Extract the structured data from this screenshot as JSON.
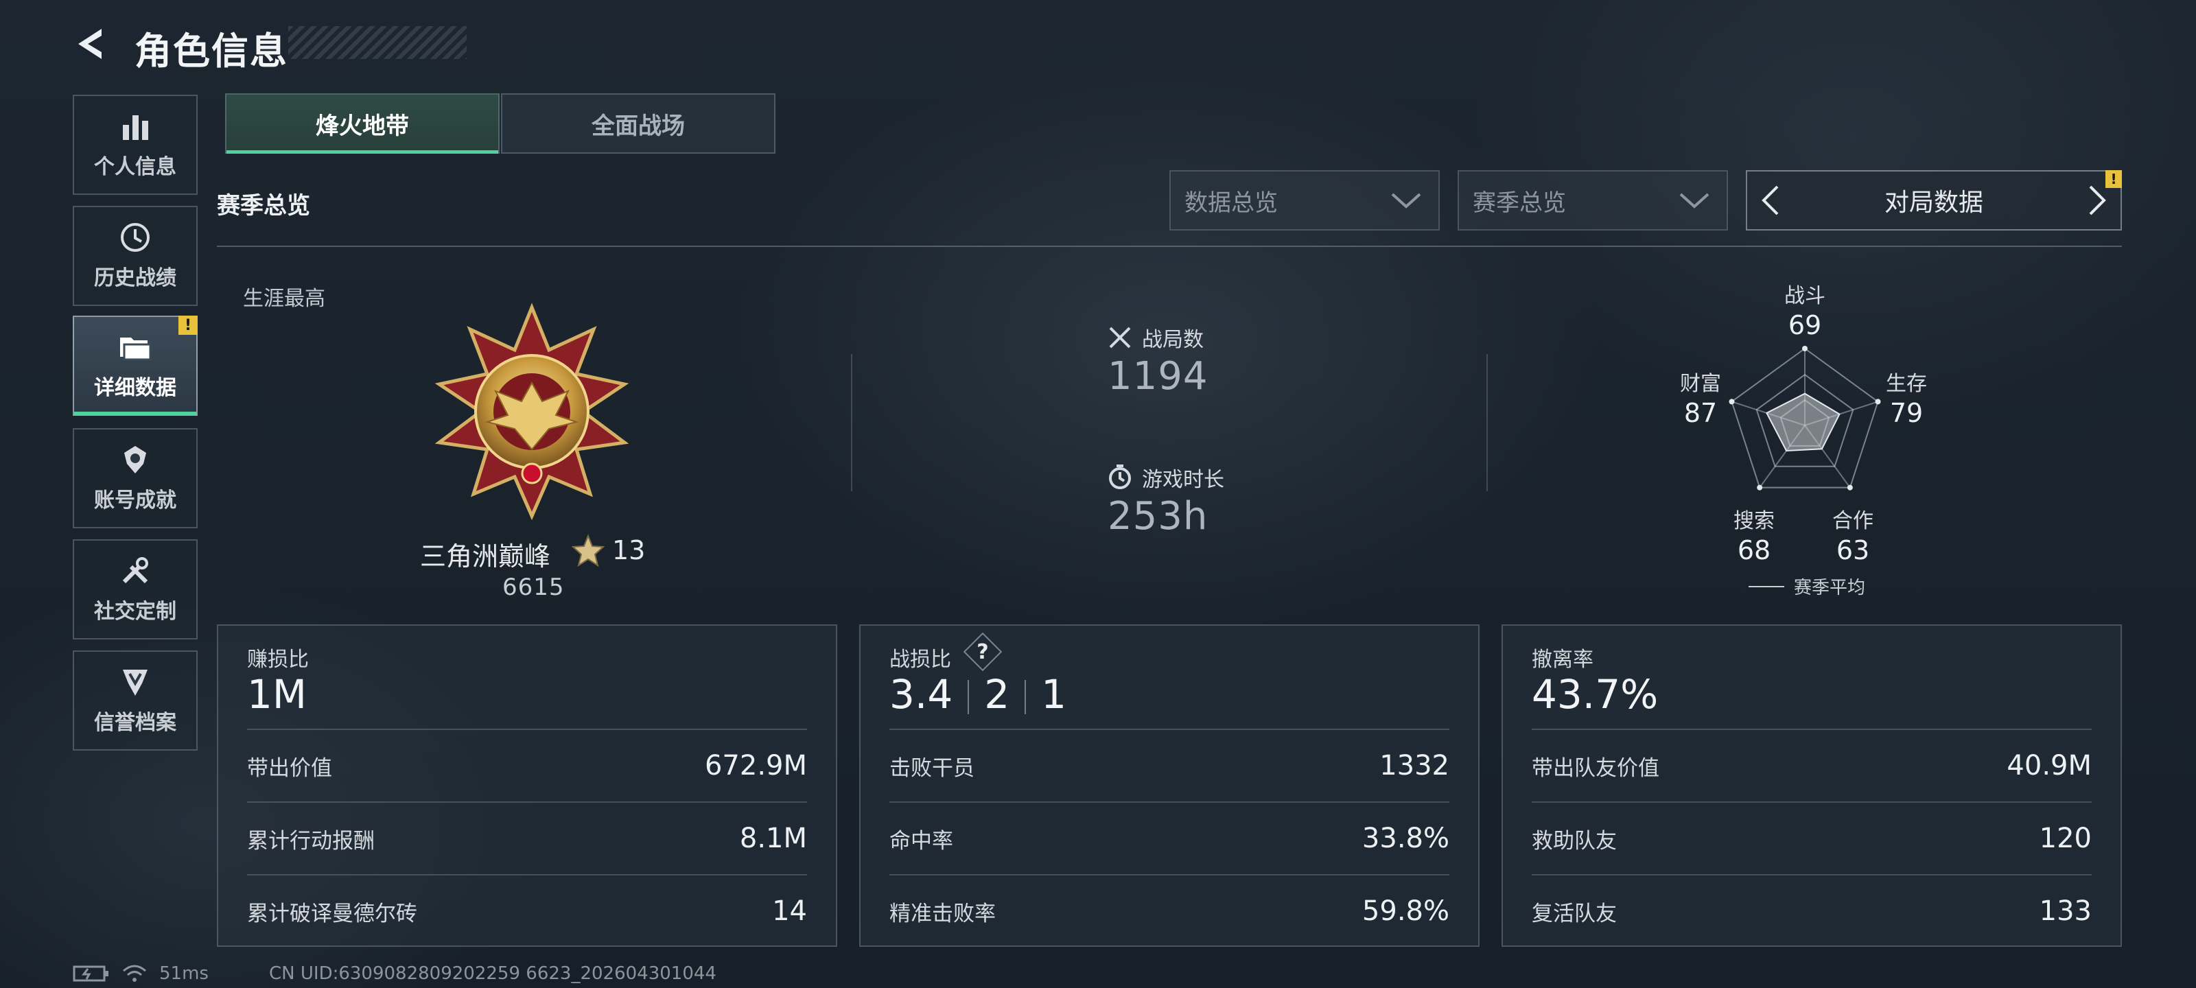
{
  "header": {
    "title": "角色信息"
  },
  "nav": {
    "items": [
      {
        "label": "个人信息",
        "icon": "bar-chart-icon"
      },
      {
        "label": "历史战绩",
        "icon": "history-clock-icon"
      },
      {
        "label": "详细数据",
        "icon": "folder-icon",
        "active": true,
        "badge": "!"
      },
      {
        "label": "账号成就",
        "icon": "achievement-icon"
      },
      {
        "label": "社交定制",
        "icon": "tools-icon"
      },
      {
        "label": "信誉档案",
        "icon": "credit-shield-icon"
      }
    ]
  },
  "mode_tabs": {
    "active": "烽火地带",
    "inactive": "全面战场"
  },
  "section": {
    "title": "赛季总览"
  },
  "filters": {
    "dropdown1": "数据总览",
    "dropdown2": "赛季总览",
    "pager_label": "对局数据",
    "pager_badge": "!"
  },
  "career": {
    "label": "生涯最高",
    "rank_name": "三角洲巅峰",
    "stars": "13",
    "score": "6615"
  },
  "overview": {
    "matches_label": "战局数",
    "matches_value": "1194",
    "playtime_label": "游戏时长",
    "playtime_value": "253h"
  },
  "radar": {
    "axes": [
      {
        "label": "战斗",
        "value": "69",
        "score": 69
      },
      {
        "label": "生存",
        "value": "79",
        "score": 79
      },
      {
        "label": "合作",
        "value": "63",
        "score": 63
      },
      {
        "label": "搜索",
        "value": "68",
        "score": 68
      },
      {
        "label": "财富",
        "value": "87",
        "score": 87
      }
    ],
    "legend": "赛季平均"
  },
  "cards": {
    "profit": {
      "title": "赚损比",
      "main": "1M",
      "rows": [
        {
          "k": "带出价值",
          "v": "672.9M"
        },
        {
          "k": "累计行动报酬",
          "v": "8.1M"
        },
        {
          "k": "累计破译曼德尔砖",
          "v": "14"
        }
      ]
    },
    "combat": {
      "title": "战损比",
      "main_a": "3.4",
      "main_b": "2",
      "main_c": "1",
      "help": "?",
      "rows": [
        {
          "k": "击败干员",
          "v": "1332"
        },
        {
          "k": "命中率",
          "v": "33.8%"
        },
        {
          "k": "精准击败率",
          "v": "59.8%"
        }
      ]
    },
    "extract": {
      "title": "撤离率",
      "main": "43.7%",
      "rows": [
        {
          "k": "带出队友价值",
          "v": "40.9M"
        },
        {
          "k": "救助队友",
          "v": "120"
        },
        {
          "k": "复活队友",
          "v": "133"
        }
      ]
    }
  },
  "status": {
    "latency": "51ms",
    "uid": "CN UID:6309082809202259 6623_202604301044"
  },
  "colors": {
    "accent": "#4fd1a0",
    "badge": "#e8c23b"
  }
}
